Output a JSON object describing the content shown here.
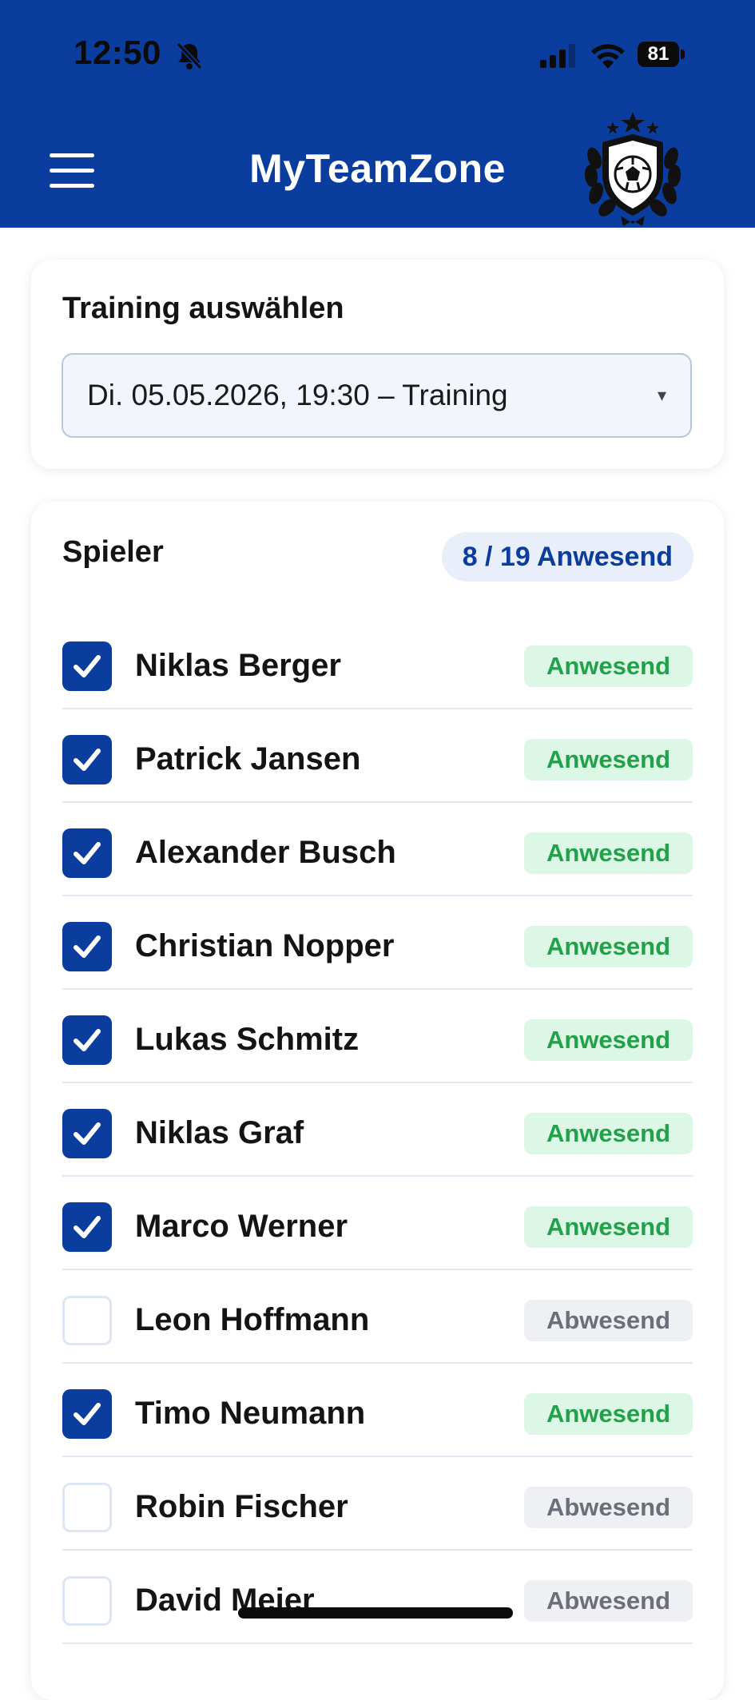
{
  "status_bar": {
    "time": "12:50",
    "battery": "81",
    "icons": [
      "bell-slash-icon",
      "signal-icon",
      "wifi-icon",
      "battery-icon"
    ]
  },
  "header": {
    "title": "MyTeamZone",
    "menu_icon": "hamburger-menu-icon",
    "logo": "club-crest-soccer-ball",
    "background_color": "#0a3d9e"
  },
  "training_select": {
    "heading": "Training auswählen",
    "selected": "Di. 05.05.2026, 19:30 – Training",
    "arrow": "▾"
  },
  "players": {
    "heading": "Spieler",
    "count_badge": "8 / 19 Anwesend",
    "list": [
      {
        "name": "Niklas Berger",
        "status": "Anwesend",
        "checked": true
      },
      {
        "name": "Patrick Jansen",
        "status": "Anwesend",
        "checked": true
      },
      {
        "name": "Alexander Busch",
        "status": "Anwesend",
        "checked": true
      },
      {
        "name": "Christian Nopper",
        "status": "Anwesend",
        "checked": true
      },
      {
        "name": "Lukas Schmitz",
        "status": "Anwesend",
        "checked": true
      },
      {
        "name": "Niklas Graf",
        "status": "Anwesend",
        "checked": true
      },
      {
        "name": "Marco Werner",
        "status": "Anwesend",
        "checked": true
      },
      {
        "name": "Leon Hoffmann",
        "status": "Abwesend",
        "checked": false
      },
      {
        "name": "Timo Neumann",
        "status": "Anwesend",
        "checked": true
      },
      {
        "name": "Robin Fischer",
        "status": "Abwesend",
        "checked": false
      },
      {
        "name": "David Meier",
        "status": "Abwesend",
        "checked": false
      }
    ]
  },
  "colors": {
    "primary": "#0a3d9e",
    "present_bg": "#dcf7e5",
    "present_text": "#23a04a",
    "absent_bg": "#eef0f4",
    "absent_text": "#6b6f78"
  }
}
